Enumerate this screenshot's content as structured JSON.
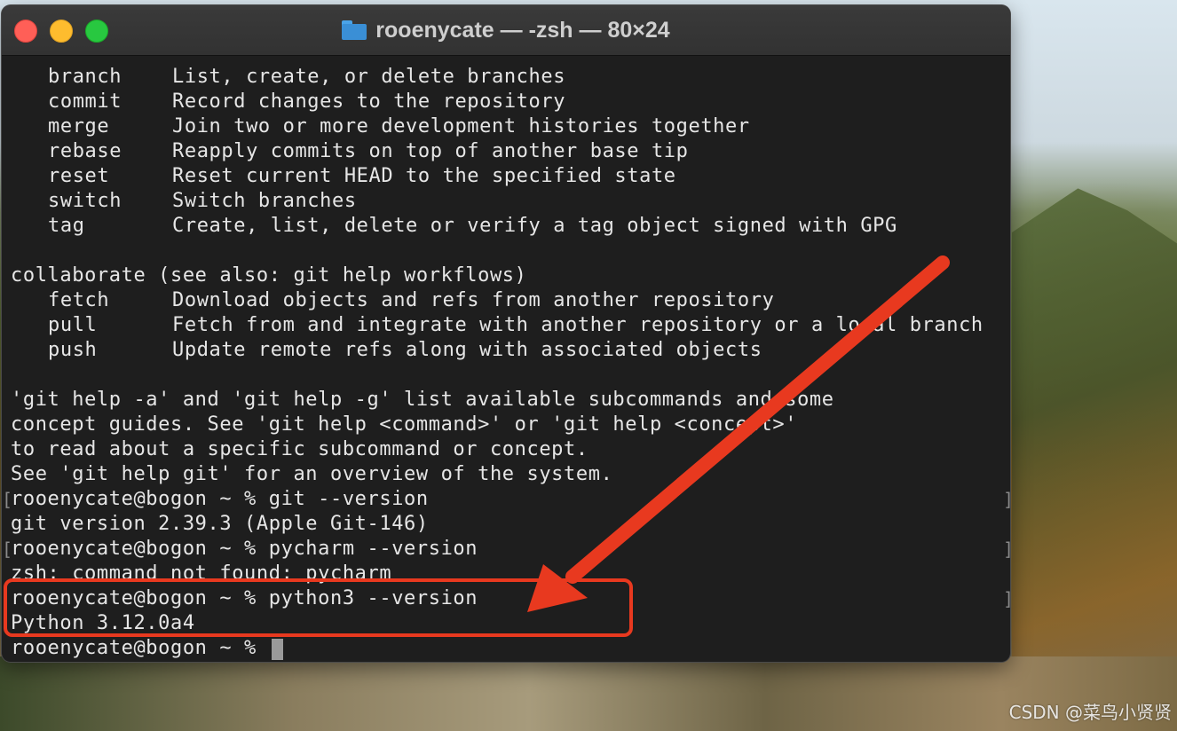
{
  "window": {
    "title": "rooenycate — -zsh — 80×24"
  },
  "terminal": {
    "commands_group_1": [
      {
        "cmd": "branch",
        "desc": "List, create, or delete branches"
      },
      {
        "cmd": "commit",
        "desc": "Record changes to the repository"
      },
      {
        "cmd": "merge",
        "desc": "Join two or more development histories together"
      },
      {
        "cmd": "rebase",
        "desc": "Reapply commits on top of another base tip"
      },
      {
        "cmd": "reset",
        "desc": "Reset current HEAD to the specified state"
      },
      {
        "cmd": "switch",
        "desc": "Switch branches"
      },
      {
        "cmd": "tag",
        "desc": "Create, list, delete or verify a tag object signed with GPG"
      }
    ],
    "collaborate_header": "collaborate (see also: git help workflows)",
    "commands_group_2": [
      {
        "cmd": "fetch",
        "desc": "Download objects and refs from another repository"
      },
      {
        "cmd": "pull",
        "desc": "Fetch from and integrate with another repository or a local branch"
      },
      {
        "cmd": "push",
        "desc": "Update remote refs along with associated objects"
      }
    ],
    "help_lines": [
      "'git help -a' and 'git help -g' list available subcommands and some",
      "concept guides. See 'git help <command>' or 'git help <concept>'",
      "to read about a specific subcommand or concept.",
      "See 'git help git' for an overview of the system."
    ],
    "session": [
      "rooenycate@bogon ~ % git --version",
      "git version 2.39.3 (Apple Git-146)",
      "rooenycate@bogon ~ % pycharm --version",
      "zsh: command not found: pycharm",
      "rooenycate@bogon ~ % python3 --version",
      "Python 3.12.0a4",
      "rooenycate@bogon ~ % "
    ]
  },
  "annotation": {
    "color": "#e8391f"
  },
  "watermark": "CSDN @菜鸟小贤贤"
}
